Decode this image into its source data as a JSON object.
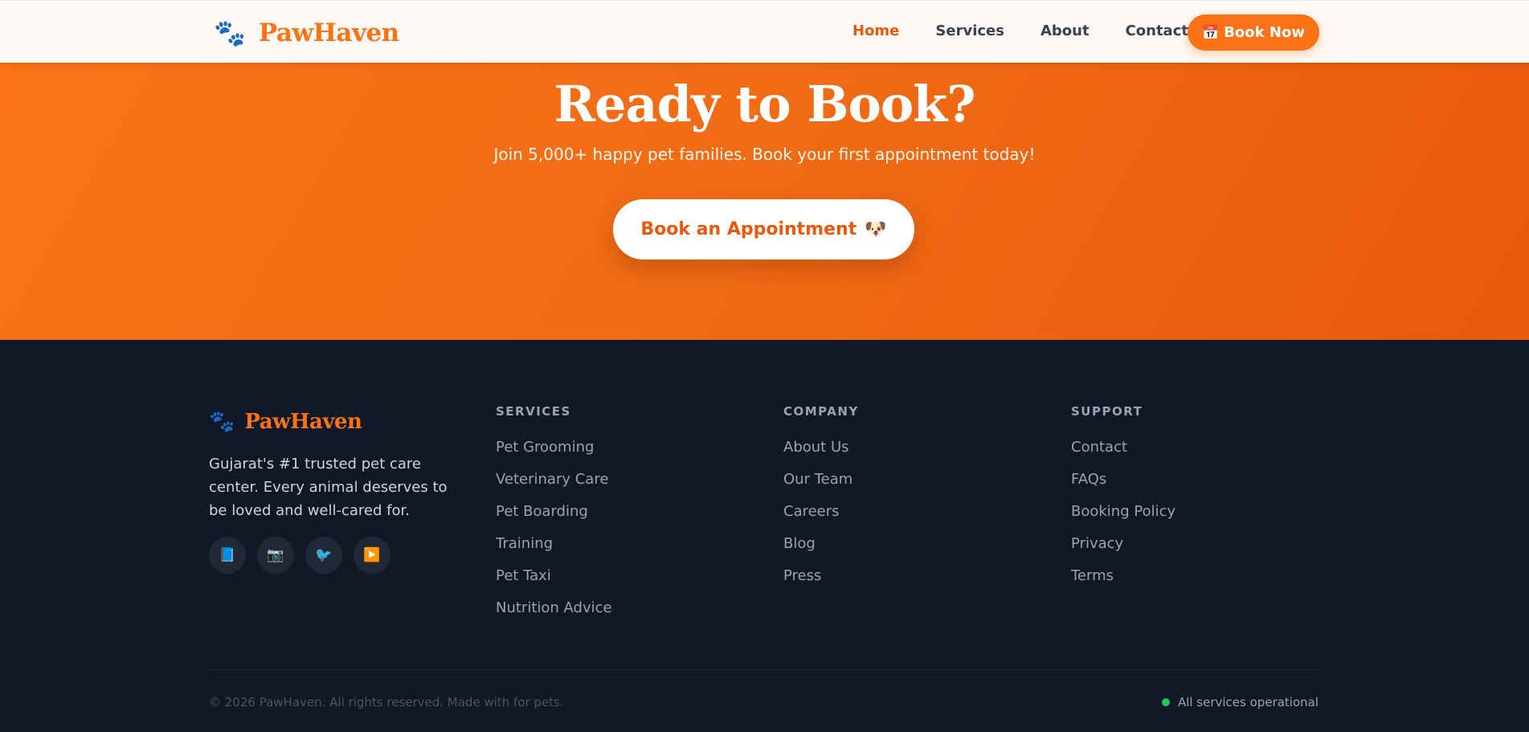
{
  "nav": {
    "brand": "PawHaven",
    "links": [
      "Home",
      "Services",
      "About",
      "Contact"
    ],
    "active": "Home",
    "book_now": "Book Now"
  },
  "hero": {
    "title": "Ready to Book?",
    "subtitle": "Join 5,000+ happy pet families. Book your first appointment today!",
    "cta": "Book an Appointment"
  },
  "footer": {
    "brand": "PawHaven",
    "description": "Gujarat's #1 trusted pet care center. Every animal deserves to be loved and well-cared for.",
    "socials": [
      "book-icon",
      "camera-icon",
      "bird-icon",
      "play-icon"
    ],
    "columns": [
      {
        "title": "SERVICES",
        "links": [
          "Pet Grooming",
          "Veterinary Care",
          "Pet Boarding",
          "Training",
          "Pet Taxi",
          "Nutrition Advice"
        ]
      },
      {
        "title": "COMPANY",
        "links": [
          "About Us",
          "Our Team",
          "Careers",
          "Blog",
          "Press"
        ]
      },
      {
        "title": "SUPPORT",
        "links": [
          "Contact",
          "FAQs",
          "Booking Policy",
          "Privacy",
          "Terms"
        ]
      }
    ],
    "copyright": "© 2026 PawHaven. All rights reserved. Made with for pets.",
    "status": "All services operational"
  },
  "colors": {
    "accent": "#f97316",
    "dark": "#111827",
    "status": "#22c55e"
  }
}
